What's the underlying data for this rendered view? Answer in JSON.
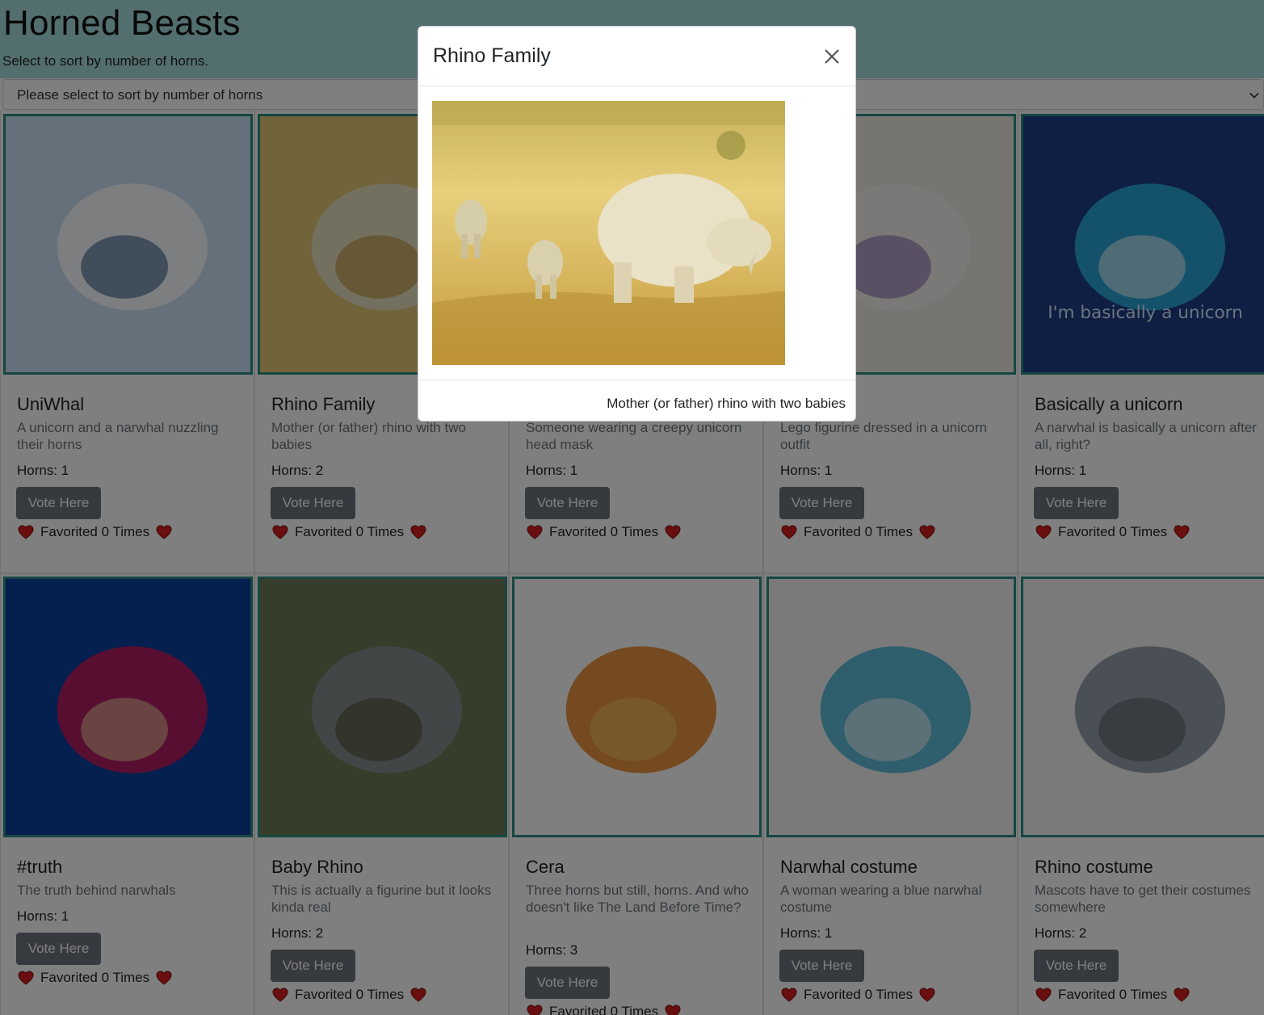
{
  "header": {
    "title": "Horned Beasts",
    "subtitle": "Select to sort by number of horns.",
    "select_placeholder": "Please select to sort by number of horns"
  },
  "colors": {
    "header_bg": "#a7dcdd",
    "card_border": "#2a8f85",
    "button_bg": "#6c757d",
    "heart": "#e0245e"
  },
  "cards": [
    {
      "title": "UniWhal",
      "desc": "A unicorn and a narwhal nuzzling their horns",
      "horns": "Horns: 1",
      "vote": "Vote Here",
      "fav": "Favorited 0 Times",
      "image": "unicorn-narwhal-illustration"
    },
    {
      "title": "Rhino Family",
      "desc": "Mother (or father) rhino with two babies",
      "horns": "Horns: 2",
      "vote": "Vote Here",
      "fav": "Favorited 0 Times",
      "image": "rhino-family-photo"
    },
    {
      "title": "",
      "desc": "Someone wearing a creepy unicorn head mask",
      "horns": "Horns: 1",
      "vote": "Vote Here",
      "fav": "Favorited 0 Times",
      "image": "unicorn-mask-photo"
    },
    {
      "title": "",
      "desc": "Lego figurine dressed in a unicorn outfit",
      "horns": "Horns: 1",
      "vote": "Vote Here",
      "fav": "Favorited 0 Times",
      "image": "lego-unicorn-photo"
    },
    {
      "title": "Basically a unicorn",
      "desc": "A narwhal is basically a unicorn after all, right?",
      "horns": "Horns: 1",
      "vote": "Vote Here",
      "fav": "Favorited 0 Times",
      "image": "narwhal-cartoon",
      "image_text": "I'm basically a unicorn"
    },
    {
      "title": "#truth",
      "desc": "The truth behind narwhals",
      "horns": "Horns: 1",
      "vote": "Vote Here",
      "fav": "Favorited 0 Times",
      "image": "narwhal-truth-illustration"
    },
    {
      "title": "Baby Rhino",
      "desc": "This is actually a figurine but it looks kinda real",
      "horns": "Horns: 2",
      "vote": "Vote Here",
      "fav": "Favorited 0 Times",
      "image": "baby-rhino-photo"
    },
    {
      "title": "Cera",
      "desc": "Three horns but still, horns. And who doesn't like The Land Before Time?",
      "horns": "Horns: 3",
      "vote": "Vote Here",
      "fav": "Favorited 0 Times",
      "image": "cera-dinosaur-cartoon"
    },
    {
      "title": "Narwhal costume",
      "desc": "A woman wearing a blue narwhal costume",
      "horns": "Horns: 1",
      "vote": "Vote Here",
      "fav": "Favorited 0 Times",
      "image": "narwhal-costume-photo"
    },
    {
      "title": "Rhino costume",
      "desc": "Mascots have to get their costumes somewhere",
      "horns": "Horns: 2",
      "vote": "Vote Here",
      "fav": "Favorited 0 Times",
      "image": "rhino-mascot-photo"
    }
  ],
  "modal": {
    "title": "Rhino Family",
    "caption": "Mother (or father) rhino with two babies",
    "close_icon": "close-icon",
    "image": "rhino-family-photo"
  }
}
